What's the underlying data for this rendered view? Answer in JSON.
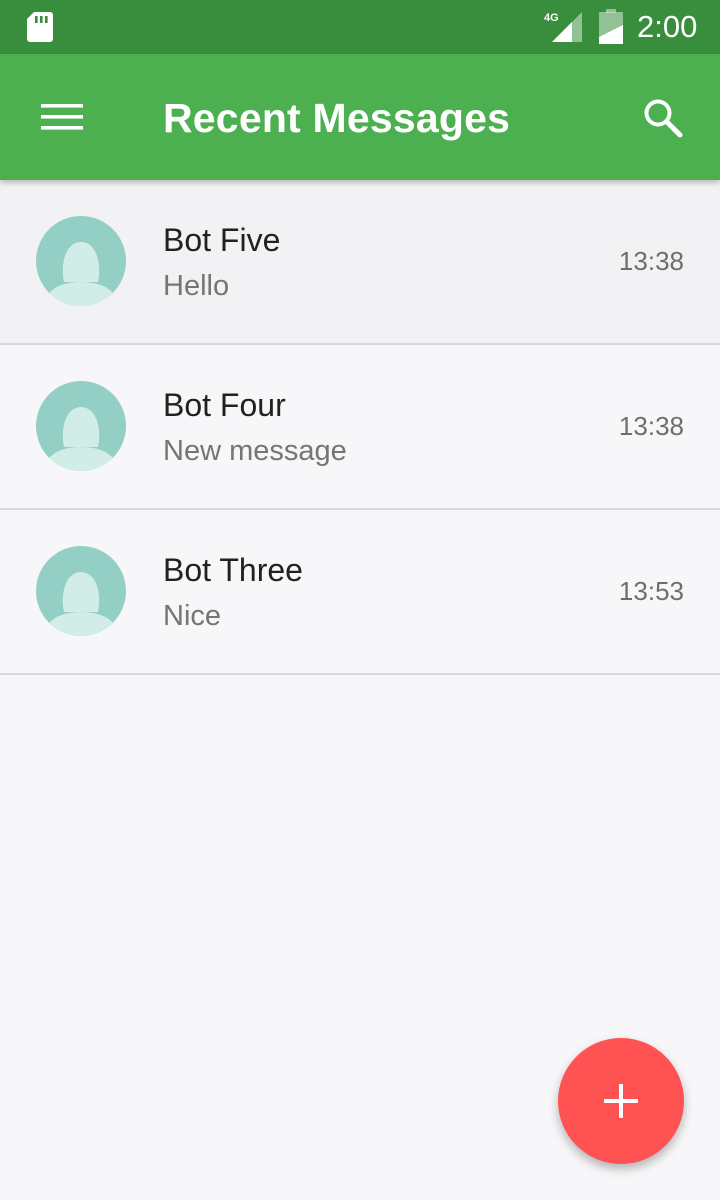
{
  "status_bar": {
    "time": "2:00",
    "network_label": "4G",
    "icons": [
      "sd-card-icon",
      "signal-icon",
      "battery-icon"
    ]
  },
  "app_bar": {
    "title": "Recent Messages",
    "menu_icon": "hamburger-menu-icon",
    "search_icon": "search-icon",
    "color": "#4caf50",
    "status_color": "#388e3c"
  },
  "conversations": [
    {
      "sender": "Bot Five",
      "preview": "Hello",
      "time": "13:38",
      "avatar_icon": "person-avatar-icon"
    },
    {
      "sender": "Bot Four",
      "preview": "New message",
      "time": "13:38",
      "avatar_icon": "person-avatar-icon"
    },
    {
      "sender": "Bot Three",
      "preview": "Nice",
      "time": "13:53",
      "avatar_icon": "person-avatar-icon"
    }
  ],
  "fab": {
    "icon": "plus-icon",
    "color": "#ff5252"
  },
  "colors": {
    "avatar_bg": "#93cfc4",
    "avatar_figure": "#d2ece7"
  }
}
